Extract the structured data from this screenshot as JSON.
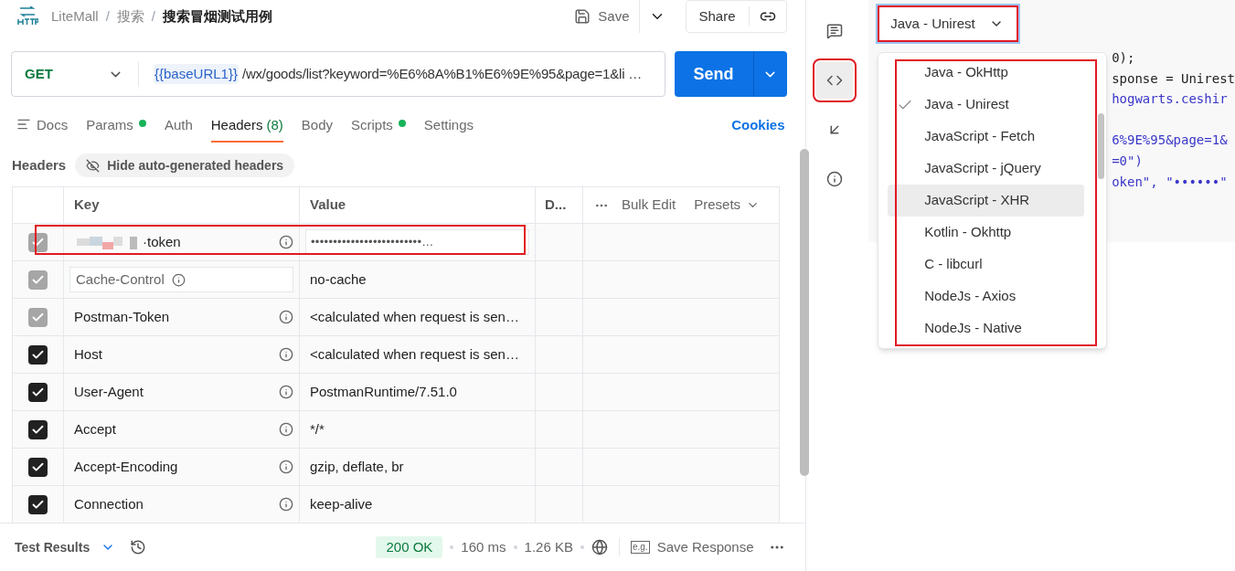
{
  "breadcrumb": [
    {
      "kind": "link",
      "text": "LiteMall"
    },
    {
      "kind": "separator",
      "text": "/"
    },
    {
      "kind": "link",
      "text": "搜索"
    },
    {
      "kind": "separator",
      "text": "/"
    },
    {
      "kind": "current",
      "text": "搜索冒烟测试用例"
    }
  ],
  "header_actions": {
    "save": "Save",
    "share": "Share"
  },
  "request": {
    "method": "GET",
    "variable": "{{baseURL1}}",
    "path": "/wx/goods/list?keyword=%E6%8A%B1%E6%9E%95&page=1&li …",
    "send": "Send"
  },
  "tabs": [
    {
      "label": "Docs",
      "indicator": false,
      "selected": false
    },
    {
      "label": "Params",
      "indicator": true,
      "selected": false
    },
    {
      "label": "Auth",
      "indicator": false,
      "selected": false
    },
    {
      "label": "Headers",
      "count": "(8)",
      "indicator": false,
      "selected": true
    },
    {
      "label": "Body",
      "indicator": false,
      "selected": false
    },
    {
      "label": "Scripts",
      "indicator": true,
      "selected": false
    },
    {
      "label": "Settings",
      "indicator": false,
      "selected": false
    }
  ],
  "cookies": "Cookies",
  "headers_bar": {
    "title": "Headers",
    "toggle": "Hide auto-generated headers"
  },
  "table": {
    "columns": [
      "Key",
      "Value",
      "D..."
    ],
    "actions": [
      "Bulk Edit",
      "Presets"
    ],
    "rows": [
      {
        "kind": "redacted",
        "key": "·token",
        "value": "•••••••••••••••••••••••••…",
        "checked": true,
        "disabled": true
      },
      {
        "kind": "editable",
        "key": "Cache-Control",
        "value": "no-cache",
        "checked": true,
        "disabled": true
      },
      {
        "kind": "plain",
        "key": "Postman-Token",
        "value": "<calculated when request is sen…",
        "checked": true,
        "disabled": true
      },
      {
        "kind": "plain",
        "key": "Host",
        "value": "<calculated when request is sen…",
        "checked": true,
        "disabled": false
      },
      {
        "kind": "plain",
        "key": "User-Agent",
        "value": "PostmanRuntime/7.51.0",
        "checked": true,
        "disabled": false
      },
      {
        "kind": "plain",
        "key": "Accept",
        "value": "*/*",
        "checked": true,
        "disabled": false
      },
      {
        "kind": "plain",
        "key": "Accept-Encoding",
        "value": "gzip, deflate, br",
        "checked": true,
        "disabled": false
      },
      {
        "kind": "plain",
        "key": "Connection",
        "value": "keep-alive",
        "checked": true,
        "disabled": false
      }
    ]
  },
  "status_bar": {
    "tests": "Test Results",
    "status": "200 OK",
    "time": "160 ms",
    "size": "1.26 KB",
    "save_icon": "e.g.",
    "save": "Save Response"
  },
  "side_icons": [
    {
      "kind": "comment",
      "selected": false
    },
    {
      "kind": "code",
      "selected": true
    },
    {
      "kind": "related",
      "selected": false
    },
    {
      "kind": "info",
      "selected": false
    }
  ],
  "code_panel": {
    "language": "Java - Unirest",
    "code_lines": [
      {
        "kind": "plain",
        "text": "0);"
      },
      {
        "kind": "plain",
        "text": "sponse = Unirest"
      },
      {
        "kind": "string",
        "text": "hogwarts.ceshir"
      },
      {
        "kind": "blank"
      },
      {
        "kind": "string",
        "text": "6%9E%95&page=1&"
      },
      {
        "kind": "string",
        "text": "=0\")"
      },
      {
        "kind": "string",
        "text": "oken\", \"••••••\""
      }
    ],
    "options": [
      {
        "label": "Java - OkHttp",
        "selected": false,
        "hovered": false
      },
      {
        "label": "Java - Unirest",
        "selected": true,
        "hovered": false
      },
      {
        "label": "JavaScript - Fetch",
        "selected": false,
        "hovered": false
      },
      {
        "label": "JavaScript - jQuery",
        "selected": false,
        "hovered": false
      },
      {
        "label": "JavaScript - XHR",
        "selected": false,
        "hovered": true
      },
      {
        "label": "Kotlin - Okhttp",
        "selected": false,
        "hovered": false
      },
      {
        "label": "C - libcurl",
        "selected": false,
        "hovered": false
      },
      {
        "label": "NodeJs - Axios",
        "selected": false,
        "hovered": false
      },
      {
        "label": "NodeJs - Native",
        "selected": false,
        "hovered": false
      }
    ]
  }
}
